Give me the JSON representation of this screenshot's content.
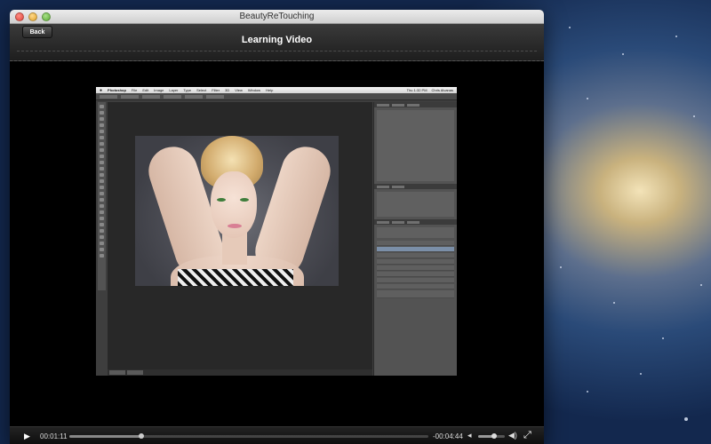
{
  "window": {
    "title": "BeautyReTouching"
  },
  "header": {
    "back_label": "Back",
    "title": "Learning Video"
  },
  "photoshop": {
    "app_name": "Photoshop",
    "menu": [
      "File",
      "Edit",
      "Image",
      "Layer",
      "Type",
      "Select",
      "Filter",
      "3D",
      "View",
      "Window",
      "Help"
    ],
    "clock": "Thu 1:32 PM",
    "user": "Chris Alvanas"
  },
  "player": {
    "elapsed": "00:01:11",
    "remaining": "-00:04:44",
    "progress": 0.2,
    "volume": 0.6
  },
  "icons": {
    "play": "play-icon",
    "volume_low": "volume-low-icon",
    "volume_high": "volume-high-icon",
    "fullscreen": "fullscreen-icon"
  }
}
